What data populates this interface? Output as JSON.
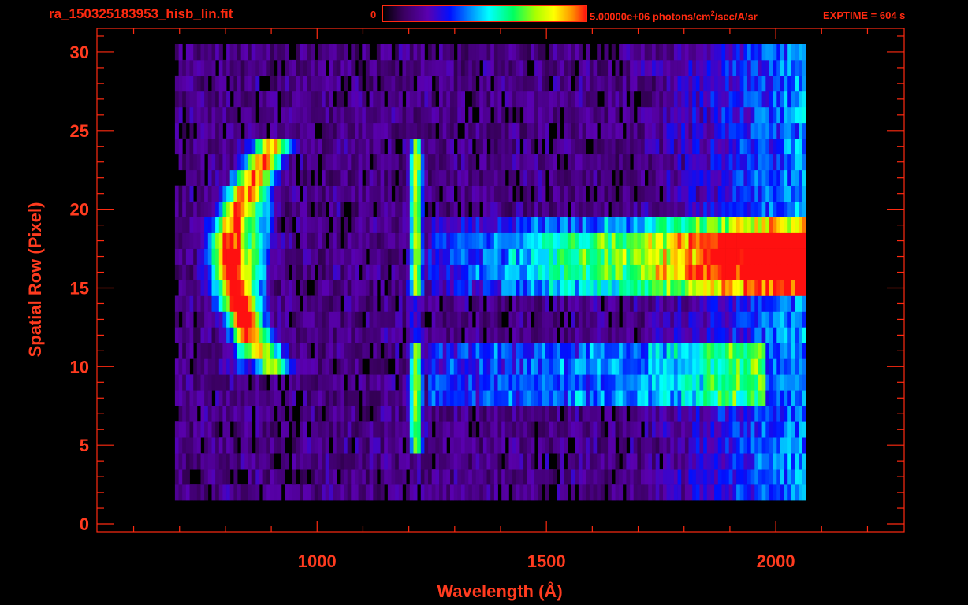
{
  "header": {
    "filename": "ra_150325183953_hisb_lin.fit",
    "colorbar_min": "0",
    "colorbar_max_prefix": "5.00000e+06 photons/cm",
    "colorbar_max_sup": "2",
    "colorbar_max_suffix": "/sec/A/sr",
    "exptime": "EXPTIME = 604 s"
  },
  "colors": {
    "axis": "#ff2a10",
    "text": "#ff3b1f",
    "background": "#000000"
  },
  "chart_data": {
    "type": "heatmap",
    "xlabel": "Wavelength (Å)",
    "ylabel": "Spatial Row (Pixel)",
    "xlim": [
      520,
      2280
    ],
    "ylim": [
      -0.5,
      31.5
    ],
    "xticks": [
      1000,
      1500,
      2000
    ],
    "yticks": [
      0,
      5,
      10,
      15,
      20,
      25,
      30
    ],
    "colorbar": {
      "min": 0,
      "max": 5000000,
      "units": "photons/cm^2/sec/A/sr"
    },
    "data_extent": {
      "x": [
        690,
        2065
      ],
      "rows": [
        2,
        30
      ]
    },
    "features": [
      {
        "name": "arc",
        "x_center": 800,
        "rows": [
          10,
          24
        ],
        "peak_intensity": 0.95
      },
      {
        "name": "emission-line",
        "x": 1216,
        "rows": [
          5,
          24
        ],
        "peak_intensity": 0.62
      },
      {
        "name": "band",
        "x": [
          1240,
          2065
        ],
        "rows": [
          15,
          19
        ],
        "peak_intensity": 0.95
      },
      {
        "name": "band",
        "x": [
          1240,
          1980
        ],
        "rows": [
          8,
          11
        ],
        "peak_intensity": 0.5
      }
    ]
  }
}
